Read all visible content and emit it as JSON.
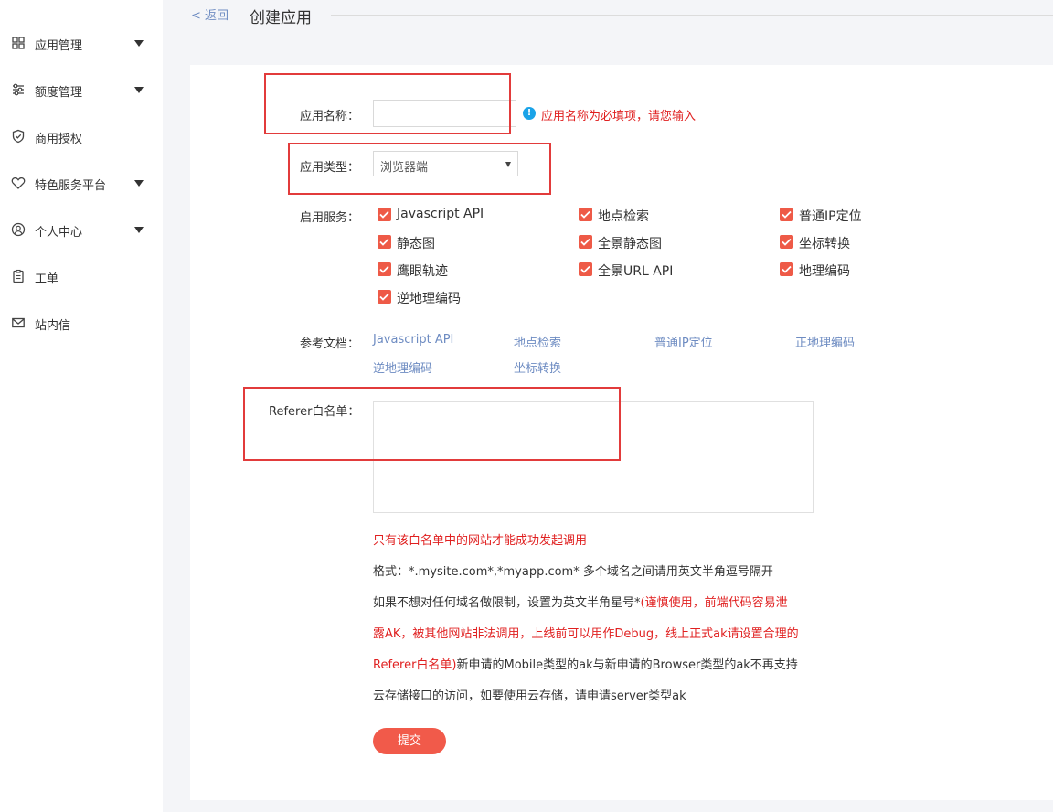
{
  "sidebar": {
    "items": [
      {
        "label": "应用管理",
        "icon": "grid-icon",
        "expandable": true
      },
      {
        "label": "额度管理",
        "icon": "sliders-icon",
        "expandable": true
      },
      {
        "label": "商用授权",
        "icon": "shield-check-icon",
        "expandable": false
      },
      {
        "label": "特色服务平台",
        "icon": "heart-tag-icon",
        "expandable": true
      },
      {
        "label": "个人中心",
        "icon": "user-circle-icon",
        "expandable": true
      },
      {
        "label": "工单",
        "icon": "clipboard-icon",
        "expandable": false
      },
      {
        "label": "站内信",
        "icon": "mail-icon",
        "expandable": false
      }
    ]
  },
  "header": {
    "back_label": "< 返回",
    "title": "创建应用"
  },
  "form": {
    "name_label": "应用名称：",
    "name_value": "",
    "name_error": "应用名称为必填项，请您输入",
    "type_label": "应用类型：",
    "type_value": "浏览器端",
    "services_label": "启用服务：",
    "services": [
      {
        "label": "Javascript API",
        "checked": true
      },
      {
        "label": "地点检索",
        "checked": true
      },
      {
        "label": "普通IP定位",
        "checked": true
      },
      {
        "label": "静态图",
        "checked": true
      },
      {
        "label": "全景静态图",
        "checked": true
      },
      {
        "label": "坐标转换",
        "checked": true
      },
      {
        "label": "鹰眼轨迹",
        "checked": true
      },
      {
        "label": "全景URL API",
        "checked": true
      },
      {
        "label": "地理编码",
        "checked": true
      },
      {
        "label": "逆地理编码",
        "checked": true
      }
    ],
    "docs_label": "参考文档：",
    "docs": [
      "Javascript API",
      "地点检索",
      "普通IP定位",
      "正地理编码",
      "逆地理编码",
      "坐标转换"
    ],
    "referer_label": "Referer白名单：",
    "referer_value": "",
    "notes": {
      "line1": "只有该白名单中的网站才能成功发起调用",
      "line2": "格式：*.mysite.com*,*myapp.com* 多个域名之间请用英文半角逗号隔开",
      "line3_a": "如果不想对任何域名做限制，设置为英文半角星号*",
      "line3_b": "(谨慎使用，前端代码容易泄",
      "line4": "露AK，被其他网站非法调用，上线前可以用作Debug，线上正式ak请设置合理的",
      "line5_a": "Referer白名单)",
      "line5_b": "新申请的Mobile类型的ak与新申请的Browser类型的ak不再支持",
      "line6": "云存储接口的访问，如要使用云存储，请申请server类型ak"
    },
    "submit_label": "提交"
  },
  "colors": {
    "accent_red": "#f15a4a",
    "link_blue": "#6e8cc2",
    "error_red": "#e02020",
    "annotation_red": "#e23b3b"
  }
}
